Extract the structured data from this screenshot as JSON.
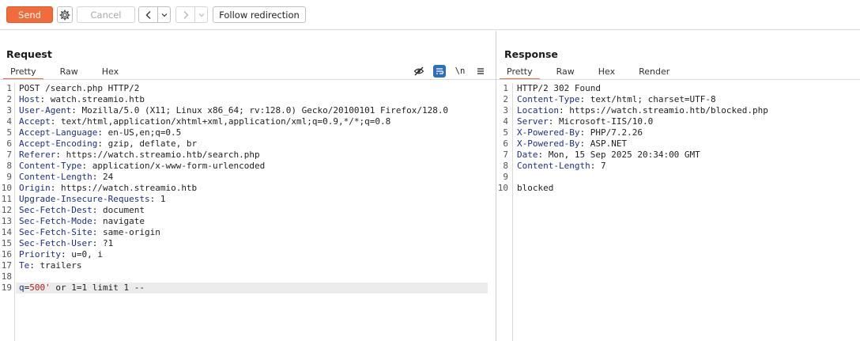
{
  "toolbar": {
    "send_label": "Send",
    "cancel_label": "Cancel",
    "follow_label": "Follow redirection"
  },
  "request": {
    "title": "Request",
    "tabs": [
      "Pretty",
      "Raw",
      "Hex"
    ],
    "active_tab": "Pretty",
    "icons": [
      "hide-icon",
      "wrap-lines-icon",
      "newline-icon",
      "menu-icon"
    ],
    "newline_glyph": "\\n",
    "lines": [
      {
        "n": "1",
        "text": "POST /search.php HTTP/2"
      },
      {
        "n": "2",
        "name": "Host",
        "value": ": watch.streamio.htb"
      },
      {
        "n": "3",
        "name": "User-Agent",
        "value": ": Mozilla/5.0 (X11; Linux x86_64; rv:128.0) Gecko/20100101 Firefox/128.0"
      },
      {
        "n": "4",
        "name": "Accept",
        "value": ": text/html,application/xhtml+xml,application/xml;q=0.9,*/*;q=0.8"
      },
      {
        "n": "5",
        "name": "Accept-Language",
        "value": ": en-US,en;q=0.5"
      },
      {
        "n": "6",
        "name": "Accept-Encoding",
        "value": ": gzip, deflate, br"
      },
      {
        "n": "7",
        "name": "Referer",
        "value": ": https://watch.streamio.htb/search.php"
      },
      {
        "n": "8",
        "name": "Content-Type",
        "value": ": application/x-www-form-urlencoded"
      },
      {
        "n": "9",
        "name": "Content-Length",
        "value": ": 24"
      },
      {
        "n": "10",
        "name": "Origin",
        "value": ": https://watch.streamio.htb"
      },
      {
        "n": "11",
        "name": "Upgrade-Insecure-Requests",
        "value": ": 1"
      },
      {
        "n": "12",
        "name": "Sec-Fetch-Dest",
        "value": ": document"
      },
      {
        "n": "13",
        "name": "Sec-Fetch-Mode",
        "value": ": navigate"
      },
      {
        "n": "14",
        "name": "Sec-Fetch-Site",
        "value": ": same-origin"
      },
      {
        "n": "15",
        "name": "Sec-Fetch-User",
        "value": ": ?1"
      },
      {
        "n": "16",
        "name": "Priority",
        "value": ": u=0, i"
      },
      {
        "n": "17",
        "name": "Te",
        "value": ": trailers"
      },
      {
        "n": "18",
        "text": ""
      },
      {
        "n": "19",
        "param_key": "q",
        "param_eq": "=",
        "param_val": "500'",
        "param_rest": " or 1=1 limit 1 --"
      }
    ]
  },
  "response": {
    "title": "Response",
    "tabs": [
      "Pretty",
      "Raw",
      "Hex",
      "Render"
    ],
    "active_tab": "Pretty",
    "lines": [
      {
        "n": "1",
        "text": "HTTP/2 302 Found"
      },
      {
        "n": "2",
        "name": "Content-Type",
        "value": ": text/html; charset=UTF-8"
      },
      {
        "n": "3",
        "name": "Location",
        "value": ": https://watch.streamio.htb/blocked.php"
      },
      {
        "n": "4",
        "name": "Server",
        "value": ": Microsoft-IIS/10.0"
      },
      {
        "n": "5",
        "name": "X-Powered-By",
        "value": ": PHP/7.2.26"
      },
      {
        "n": "6",
        "name": "X-Powered-By",
        "value": ": ASP.NET"
      },
      {
        "n": "7",
        "name": "Date",
        "value": ": Mon, 15 Sep 2025 20:34:00 GMT"
      },
      {
        "n": "8",
        "name": "Content-Length",
        "value": ": 7"
      },
      {
        "n": "9",
        "text": ""
      },
      {
        "n": "10",
        "text": "blocked"
      }
    ]
  },
  "colors": {
    "accent": "#f26b3a",
    "header_name": "#1b2e8a",
    "param_value": "#b3261e"
  }
}
